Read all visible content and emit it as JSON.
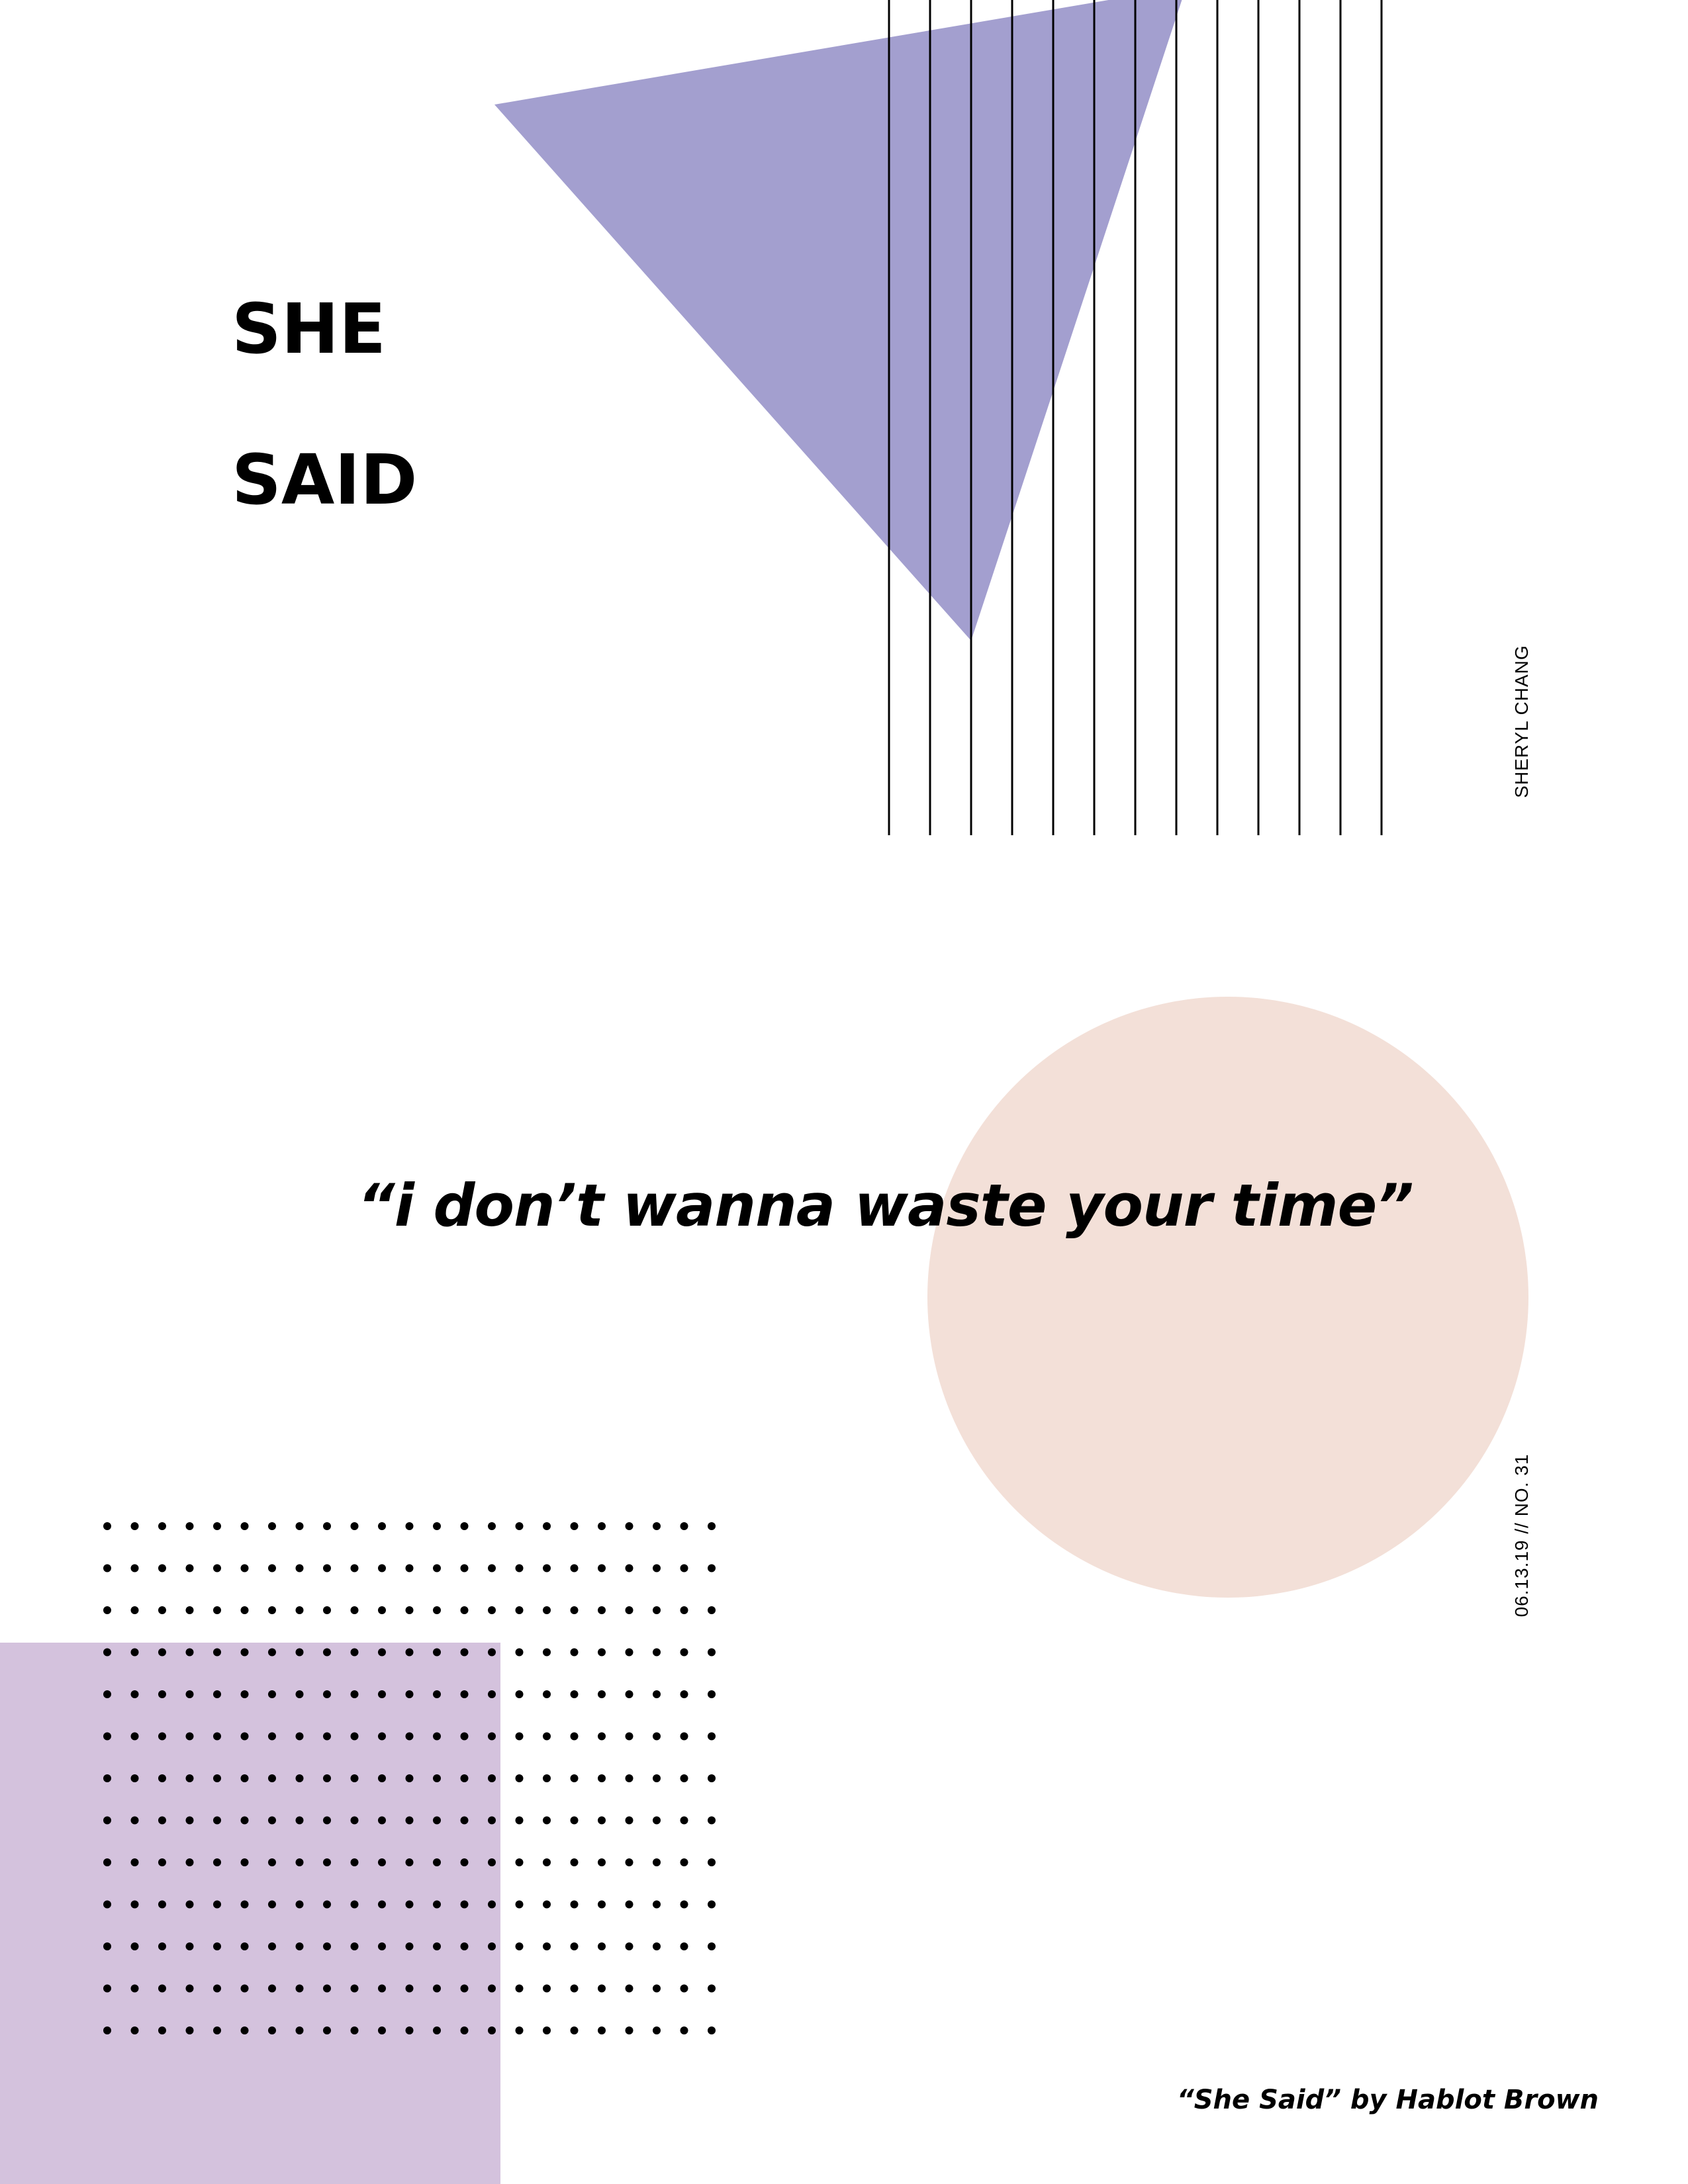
{
  "poster": {
    "title": "SHE\n\nSAID",
    "author": "SHERYL CHANG",
    "issue": "06.13.19  //  NO. 31",
    "quote": "“i don’t wanna waste your time”",
    "credit": "“She Said” by Hablot Brown"
  },
  "colors": {
    "background": "#ffffff",
    "triangle": "#a39fcf",
    "circle": "#f3e0d8",
    "square": "#d4c2dd",
    "ink": "#000000"
  }
}
